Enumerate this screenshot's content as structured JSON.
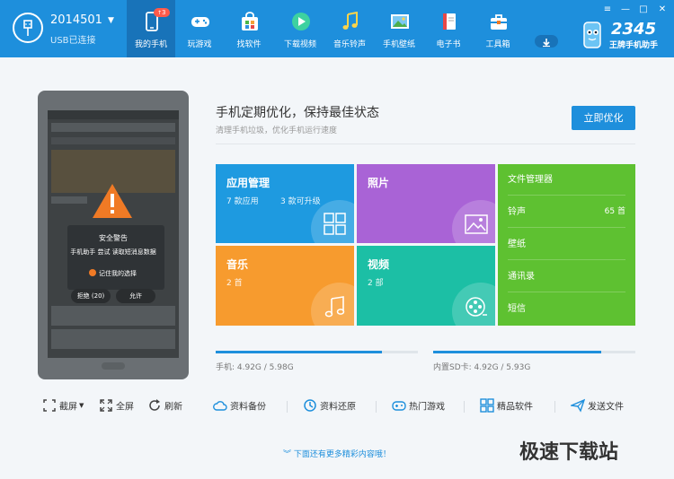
{
  "device": {
    "name": "2014501",
    "status": "USB已连接"
  },
  "nav": [
    {
      "label": "我的手机",
      "badge": "3",
      "icon": "phone-icon",
      "active": true
    },
    {
      "label": "玩游戏",
      "icon": "gamepad-icon"
    },
    {
      "label": "找软件",
      "icon": "app-store-icon"
    },
    {
      "label": "下载视频",
      "icon": "play-icon"
    },
    {
      "label": "音乐铃声",
      "icon": "music-note-icon"
    },
    {
      "label": "手机壁纸",
      "icon": "picture-icon"
    },
    {
      "label": "电子书",
      "icon": "book-icon"
    },
    {
      "label": "工具箱",
      "icon": "toolbox-icon"
    }
  ],
  "brand": {
    "number": "2345",
    "name": "王牌手机助手"
  },
  "phone_dialog": {
    "title": "安全警告",
    "text": "手机助手 尝试 读取短消息数据",
    "remember": "记住我的选择",
    "deny": "拒绝 (20)",
    "allow": "允许"
  },
  "main": {
    "headline": "手机定期优化，保持最佳状态",
    "subline": "清理手机垃圾，优化手机运行速度",
    "optimize_button": "立即优化"
  },
  "tiles": {
    "apps": {
      "title": "应用管理",
      "installed": "7 款应用",
      "upgradable": "3 款可升级",
      "color": "#1e9ae0"
    },
    "photos": {
      "title": "照片",
      "color": "#a963d6"
    },
    "music": {
      "title": "音乐",
      "count": "2 首",
      "color": "#f79b2e"
    },
    "video": {
      "title": "视频",
      "count": "2 部",
      "color": "#1cbfa5"
    },
    "list": {
      "color": "#5ec131",
      "items": [
        {
          "label": "文件管理器",
          "count": ""
        },
        {
          "label": "铃声",
          "count": "65 首"
        },
        {
          "label": "壁纸",
          "count": ""
        },
        {
          "label": "通讯录",
          "count": ""
        },
        {
          "label": "短信",
          "count": ""
        }
      ]
    }
  },
  "storage": {
    "phone": {
      "label": "手机: 4.92G / 5.98G",
      "fraction": 0.82
    },
    "sd": {
      "label": "内置SD卡: 4.92G / 5.93G",
      "fraction": 0.83
    }
  },
  "toolbar": {
    "screenshot": "截屏",
    "fullscreen": "全屏",
    "refresh": "刷新",
    "backup": "资料备份",
    "restore": "资料还原",
    "games": "热门游戏",
    "software": "精品软件",
    "send": "发送文件"
  },
  "more_text": "下面还有更多精彩内容哦！",
  "watermark": "极速下载站"
}
